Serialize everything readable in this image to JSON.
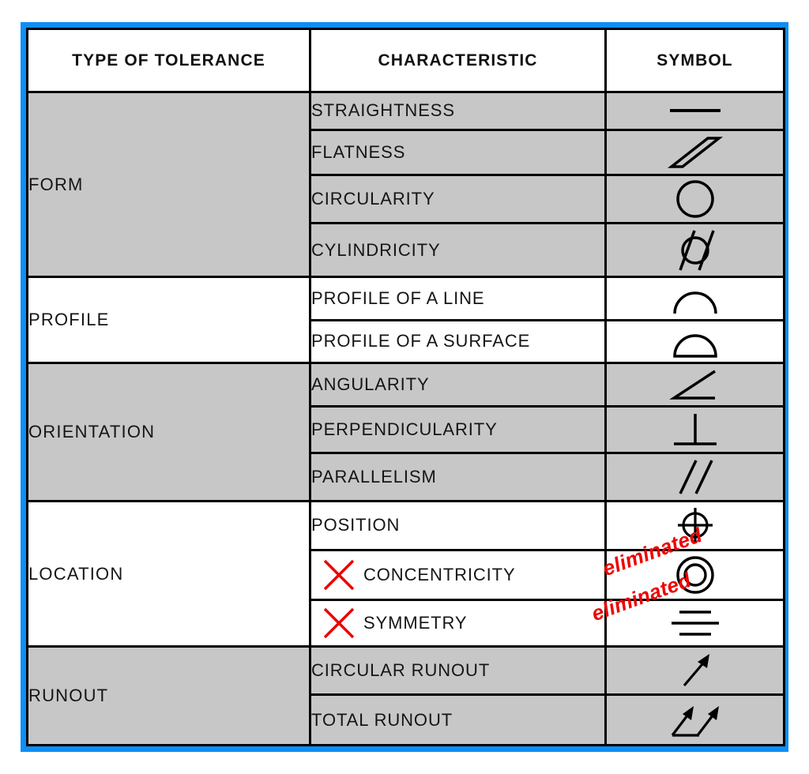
{
  "theme": {
    "frame_color": "#0d8ef5",
    "shade_color": "#c7c7c7",
    "plain_color": "#ffffff",
    "line_color": "#000000",
    "annotation_color": "#ee0000"
  },
  "header": {
    "col_type": "TYPE OF TOLERANCE",
    "col_characteristic": "CHARACTERISTIC",
    "col_symbol": "SYMBOL"
  },
  "groups": [
    {
      "name": "FORM",
      "shaded": true,
      "rows": [
        {
          "characteristic": "STRAIGHTNESS",
          "symbol": "straightness-symbol",
          "struck": false,
          "annotation": ""
        },
        {
          "characteristic": "FLATNESS",
          "symbol": "flatness-symbol",
          "struck": false,
          "annotation": ""
        },
        {
          "characteristic": "CIRCULARITY",
          "symbol": "circularity-symbol",
          "struck": false,
          "annotation": ""
        },
        {
          "characteristic": "CYLINDRICITY",
          "symbol": "cylindricity-symbol",
          "struck": false,
          "annotation": ""
        }
      ]
    },
    {
      "name": "PROFILE",
      "shaded": false,
      "rows": [
        {
          "characteristic": "PROFILE OF A LINE",
          "symbol": "profile-of-a-line-symbol",
          "struck": false,
          "annotation": ""
        },
        {
          "characteristic": "PROFILE OF A SURFACE",
          "symbol": "profile-of-a-surface-symbol",
          "struck": false,
          "annotation": ""
        }
      ]
    },
    {
      "name": "ORIENTATION",
      "shaded": true,
      "rows": [
        {
          "characteristic": "ANGULARITY",
          "symbol": "angularity-symbol",
          "struck": false,
          "annotation": ""
        },
        {
          "characteristic": "PERPENDICULARITY",
          "symbol": "perpendicularity-symbol",
          "struck": false,
          "annotation": ""
        },
        {
          "characteristic": "PARALLELISM",
          "symbol": "parallelism-symbol",
          "struck": false,
          "annotation": ""
        }
      ]
    },
    {
      "name": "LOCATION",
      "shaded": false,
      "rows": [
        {
          "characteristic": "POSITION",
          "symbol": "position-symbol",
          "struck": false,
          "annotation": ""
        },
        {
          "characteristic": "CONCENTRICITY",
          "symbol": "concentricity-symbol",
          "struck": true,
          "annotation": "eliminated"
        },
        {
          "characteristic": "SYMMETRY",
          "symbol": "symmetry-symbol",
          "struck": true,
          "annotation": "eliminated"
        }
      ]
    },
    {
      "name": "RUNOUT",
      "shaded": true,
      "rows": [
        {
          "characteristic": "CIRCULAR RUNOUT",
          "symbol": "circular-runout-symbol",
          "struck": false,
          "annotation": ""
        },
        {
          "characteristic": "TOTAL RUNOUT",
          "symbol": "total-runout-symbol",
          "struck": false,
          "annotation": ""
        }
      ]
    }
  ]
}
